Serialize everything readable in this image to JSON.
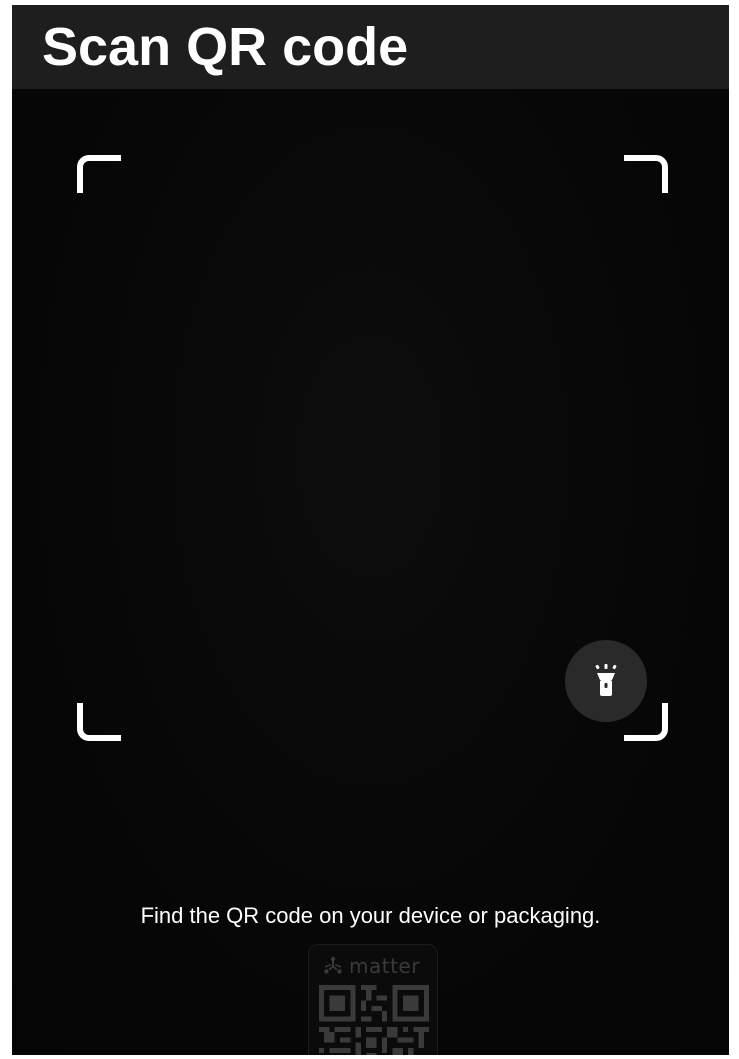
{
  "header": {
    "title": "Scan QR code",
    "background": "#1e1e1e"
  },
  "scanner": {
    "frame_color": "#ffffff",
    "torch_button": {
      "icon": "flashlight-icon",
      "background": "#2a2a2a"
    }
  },
  "instruction": {
    "text": "Find the QR code on your device or packaging."
  },
  "example": {
    "logo_icon": "matter-logo-icon",
    "logo_text": "matter",
    "qr_icon": "qr-code-icon",
    "muted_color": "#3a3a3a"
  }
}
